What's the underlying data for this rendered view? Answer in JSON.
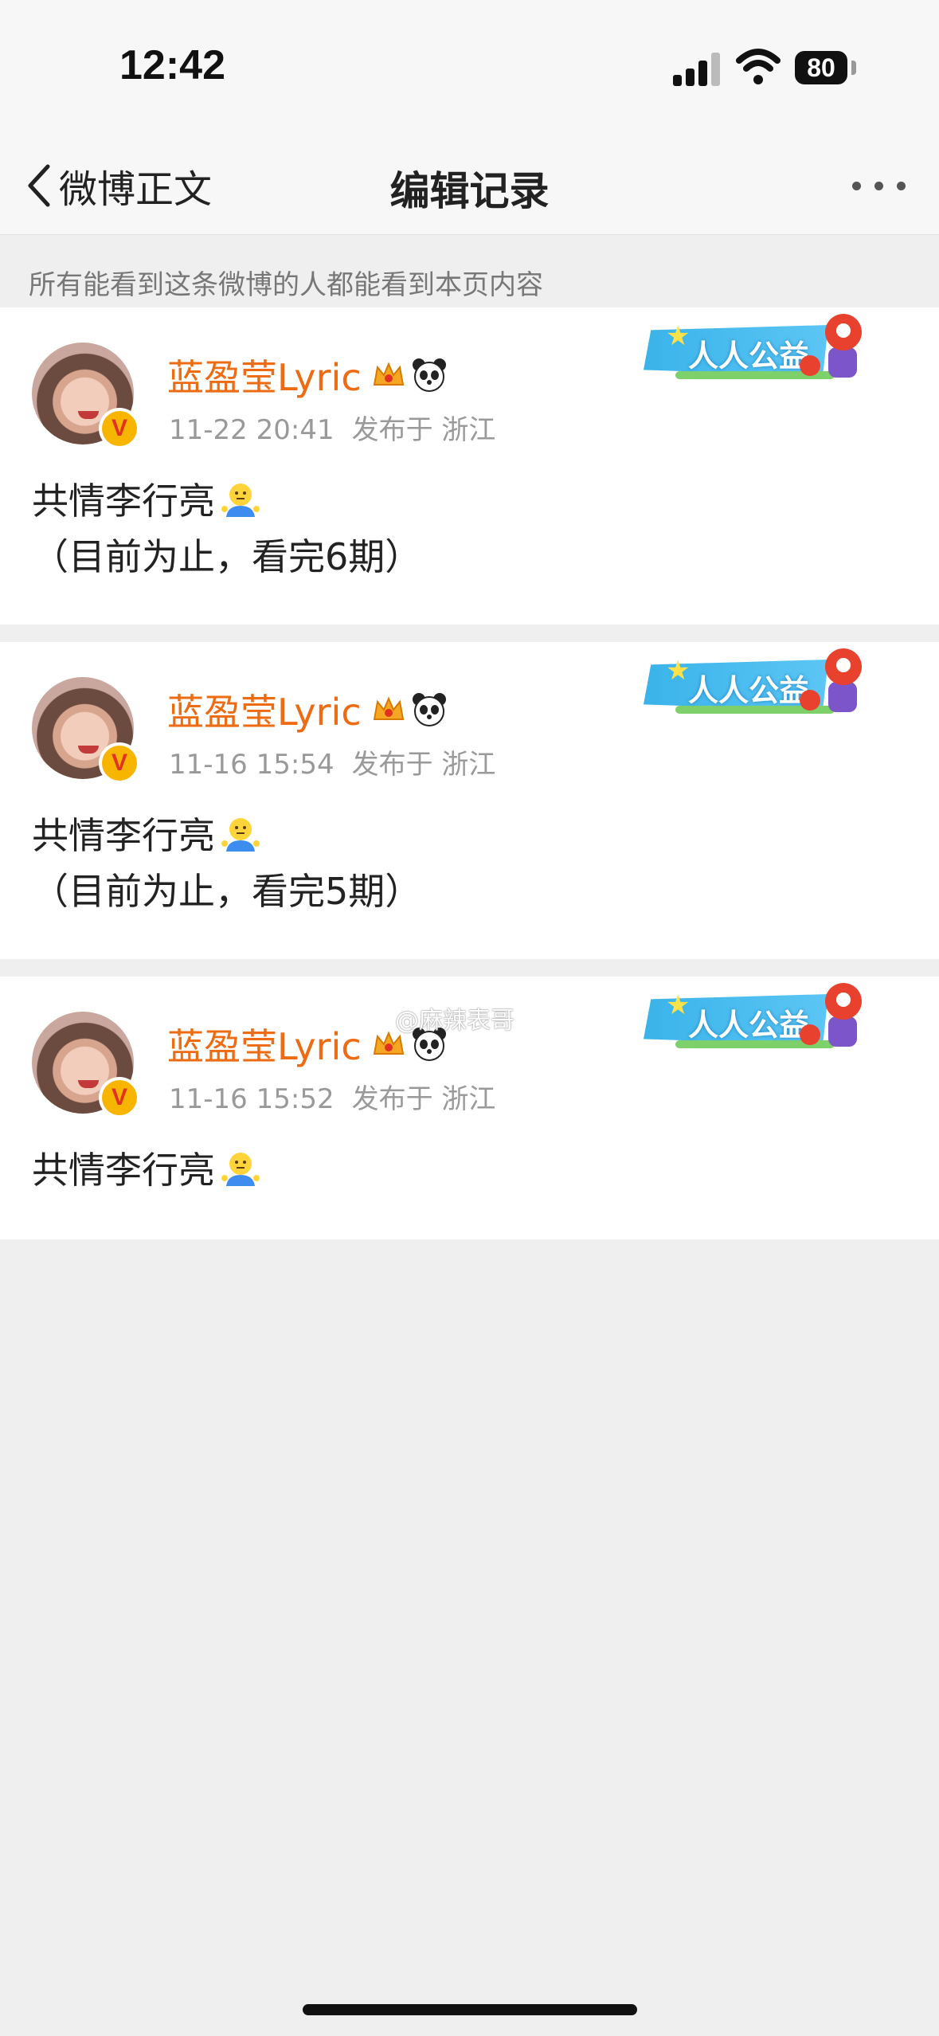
{
  "status": {
    "time": "12:42",
    "battery": "80"
  },
  "nav": {
    "back_label": "微博正文",
    "title": "编辑记录"
  },
  "notice": "所有能看到这条微博的人都能看到本页内容",
  "badge_text": "人人公益",
  "watermark": "@麻辣表哥",
  "records": [
    {
      "user": "蓝盈莹Lyric",
      "time": "11-22 20:41",
      "location": "发布于 浙江",
      "lines": [
        "共情李行亮",
        "（目前为止，看完6期）"
      ]
    },
    {
      "user": "蓝盈莹Lyric",
      "time": "11-16 15:54",
      "location": "发布于 浙江",
      "lines": [
        "共情李行亮",
        "（目前为止，看完5期）"
      ]
    },
    {
      "user": "蓝盈莹Lyric",
      "time": "11-16 15:52",
      "location": "发布于 浙江",
      "lines": [
        "共情李行亮"
      ]
    }
  ],
  "icons": {
    "verified": "verified-v-icon",
    "crown": "crown-icon",
    "panda": "panda-icon",
    "emoji": "shrug-emoji-icon"
  }
}
